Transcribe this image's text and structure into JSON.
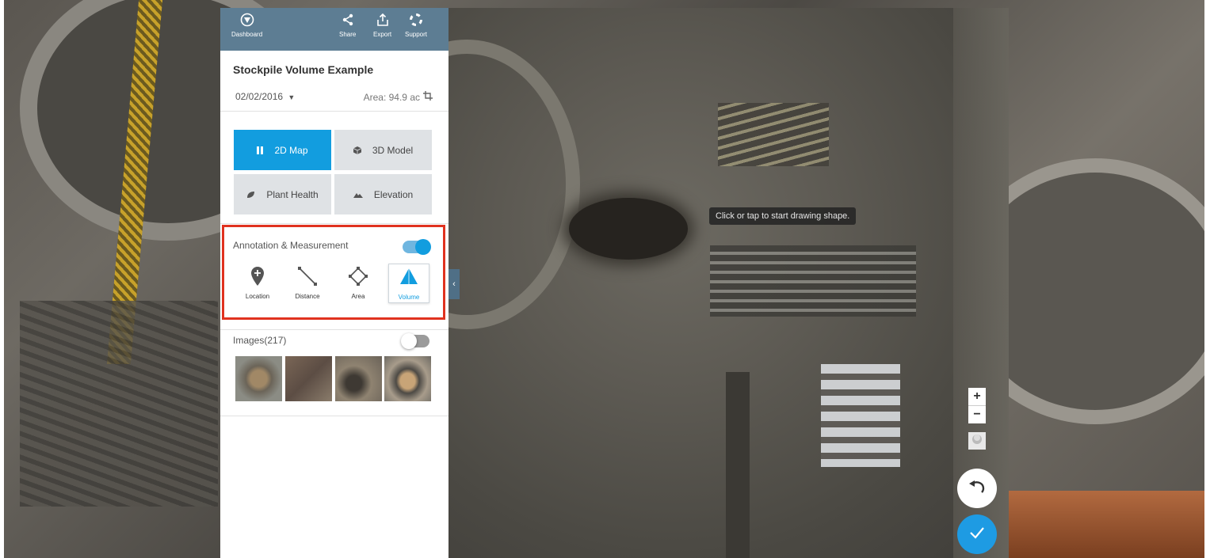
{
  "header": {
    "dashboard_label": "Dashboard",
    "share_label": "Share",
    "export_label": "Export",
    "support_label": "Support"
  },
  "project": {
    "title": "Stockpile Volume Example",
    "date": "02/02/2016",
    "area": "Area: 94.9 ac"
  },
  "view_modes": [
    {
      "label": "2D Map",
      "icon": "map-icon",
      "active": true
    },
    {
      "label": "3D Model",
      "icon": "cube-icon",
      "active": false
    },
    {
      "label": "Plant Health",
      "icon": "leaf-icon",
      "active": false
    },
    {
      "label": "Elevation",
      "icon": "mountain-icon",
      "active": false
    }
  ],
  "annotation": {
    "title": "Annotation & Measurement",
    "enabled": true,
    "tools": [
      {
        "label": "Location",
        "icon": "location-pin-icon"
      },
      {
        "label": "Distance",
        "icon": "ruler-line-icon"
      },
      {
        "label": "Area",
        "icon": "polygon-icon"
      },
      {
        "label": "Volume",
        "icon": "cone-icon",
        "active": true
      }
    ]
  },
  "images": {
    "title": "Images(217)",
    "enabled": false
  },
  "map": {
    "tooltip": "Click or tap to start drawing shape.",
    "zoom_in": "+",
    "zoom_out": "−"
  },
  "colors": {
    "accent": "#129ddf",
    "header": "#5d7d93",
    "highlight_border": "#e0321f"
  }
}
